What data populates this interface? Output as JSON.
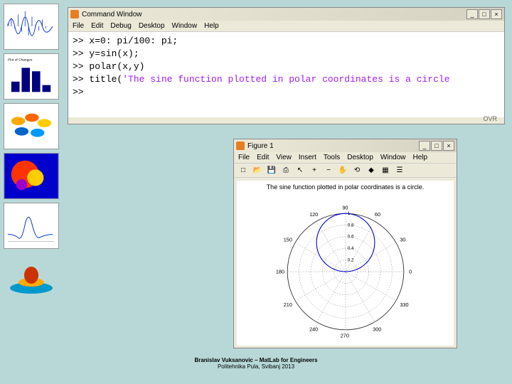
{
  "cmdWindow": {
    "title": "Command Window",
    "menu": [
      "File",
      "Edit",
      "Debug",
      "Desktop",
      "Window",
      "Help"
    ],
    "winControls": {
      "min": "_",
      "max": "□",
      "close": "×"
    },
    "status": "OVR",
    "lines": {
      "l1_prefix": ">> x=0: pi/100: pi;",
      "l2_prefix": ">> y=sin(x);",
      "l3_prefix": ">> polar(x,y)",
      "l4_prefix": ">> title(",
      "l4_string": "'The sine function plotted in polar coordinates is a circle",
      "l5_prefix": ">> "
    }
  },
  "figWindow": {
    "title": "Figure 1",
    "menu": [
      "File",
      "Edit",
      "View",
      "Insert",
      "Tools",
      "Desktop",
      "Window",
      "Help"
    ],
    "winControls": {
      "min": "_",
      "max": "□",
      "close": "×"
    },
    "plotTitle": "The sine function plotted in polar coordinates is a circle."
  },
  "chart_data": {
    "type": "polar",
    "title": "The sine function plotted in polar coordinates is a circle.",
    "radial_ticks": [
      0.2,
      0.4,
      0.6,
      0.8,
      1
    ],
    "angle_ticks_deg": [
      0,
      30,
      60,
      90,
      120,
      150,
      180,
      210,
      240,
      270,
      300,
      330
    ],
    "series": [
      {
        "name": "sin(x)",
        "theta_range_deg": [
          0,
          180
        ],
        "description": "r = sin(theta), forms a circle of radius 0.5 centered at (0, 0.5)"
      }
    ]
  },
  "footer": {
    "line1": "Branislav Vuksanovic – MatLab for Engineers",
    "line2": "Politehnika Pula, Svibanj 2013"
  },
  "thumbnails": [
    "signal-plot",
    "bar-chart",
    "surface-3d",
    "fractal",
    "sinc-plot",
    "hat-surface"
  ],
  "icons": {
    "new": "□",
    "open": "📂",
    "save": "💾",
    "print": "⎙",
    "pointer": "↖",
    "zoomin": "+",
    "zoomout": "−",
    "pan": "✋",
    "rotate": "⟲",
    "datatip": "◆",
    "colorbar": "▦",
    "legend": "☰"
  }
}
